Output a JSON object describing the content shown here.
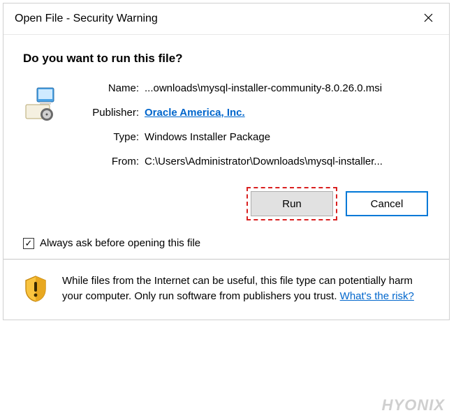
{
  "titlebar": {
    "title": "Open File - Security Warning"
  },
  "heading": "Do you want to run this file?",
  "info": {
    "name_label": "Name:",
    "name_value": "...ownloads\\mysql-installer-community-8.0.26.0.msi",
    "publisher_label": "Publisher:",
    "publisher_value": "Oracle America, Inc.",
    "type_label": "Type:",
    "type_value": "Windows Installer Package",
    "from_label": "From:",
    "from_value": "C:\\Users\\Administrator\\Downloads\\mysql-installer..."
  },
  "actions": {
    "run": "Run",
    "cancel": "Cancel"
  },
  "checkbox": {
    "label": "Always ask before opening this file",
    "checked": "✓"
  },
  "footer": {
    "text": "While files from the Internet can be useful, this file type can potentially harm your computer. Only run software from publishers you trust. ",
    "link": "What's the risk?"
  },
  "watermark": "HYONIX"
}
